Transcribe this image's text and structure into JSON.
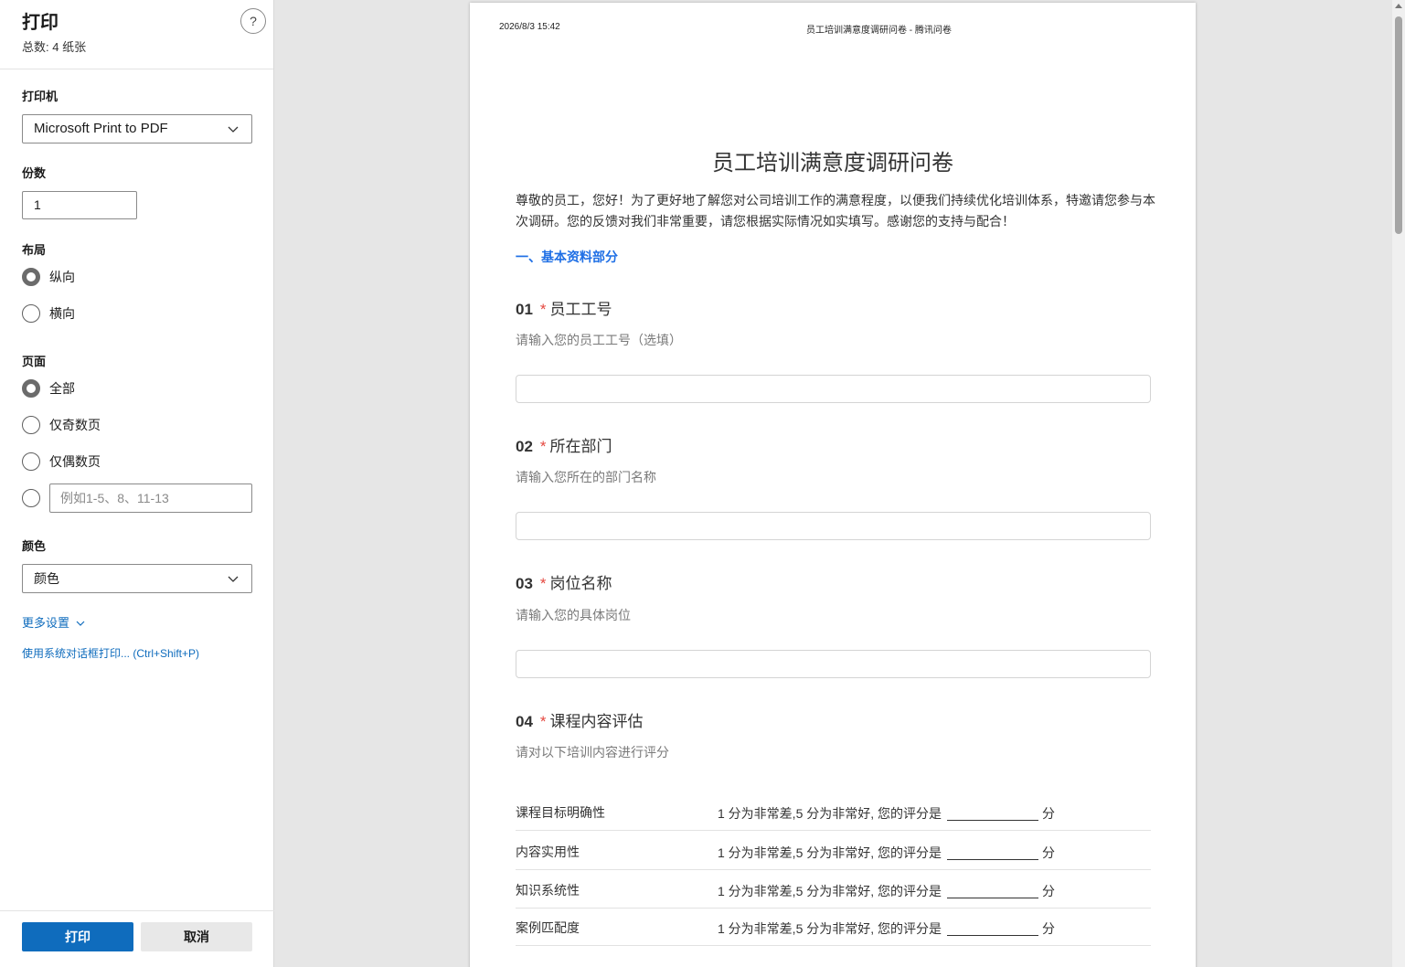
{
  "panel": {
    "title": "打印",
    "subtitle": "总数: 4 纸张",
    "help_label": "?",
    "printer_label": "打印机",
    "printer_value": "Microsoft Print to PDF",
    "copies_label": "份数",
    "copies_value": "1",
    "layout_label": "布局",
    "layout_options": [
      "纵向",
      "横向"
    ],
    "layout_selected": "纵向",
    "pages_label": "页面",
    "pages_options": [
      "全部",
      "仅奇数页",
      "仅偶数页"
    ],
    "pages_selected": "全部",
    "pages_custom_placeholder": "例如1-5、8、11-13",
    "color_label": "颜色",
    "color_value": "颜色",
    "more_settings": "更多设置",
    "system_dialog": "使用系统对话框打印... (Ctrl+Shift+P)",
    "print_button": "打印",
    "cancel_button": "取消"
  },
  "sheet": {
    "header_date": "2026/8/3 15:42",
    "header_title": "员工培训满意度调研问卷 - 腾讯问卷",
    "title": "员工培训满意度调研问卷",
    "intro": "尊敬的员工，您好！为了更好地了解您对公司培训工作的满意程度，以便我们持续优化培训体系，特邀请您参与本次调研。您的反馈对我们非常重要，请您根据实际情况如实填写。感谢您的支持与配合！",
    "section": "一、基本资料部分",
    "questions": [
      {
        "num": "01",
        "star": "*",
        "title": "员工工号",
        "hint": "请输入您的员工工号（选填）"
      },
      {
        "num": "02",
        "star": "*",
        "title": "所在部门",
        "hint": "请输入您所在的部门名称"
      },
      {
        "num": "03",
        "star": "*",
        "title": "岗位名称",
        "hint": "请输入您的具体岗位"
      },
      {
        "num": "04",
        "star": "*",
        "title": "课程内容评估",
        "hint": "请对以下培训内容进行评分"
      }
    ],
    "rating_rows": [
      {
        "name": "课程目标明确性",
        "desc": "1 分为非常差,5 分为非常好, 您的评分是",
        "unit": "分"
      },
      {
        "name": "内容实用性",
        "desc": "1 分为非常差,5 分为非常好, 您的评分是",
        "unit": "分"
      },
      {
        "name": "知识系统性",
        "desc": "1 分为非常差,5 分为非常好, 您的评分是",
        "unit": "分"
      },
      {
        "name": "案例匹配度",
        "desc": "1 分为非常差,5 分为非常好, 您的评分是",
        "unit": "分"
      }
    ]
  }
}
